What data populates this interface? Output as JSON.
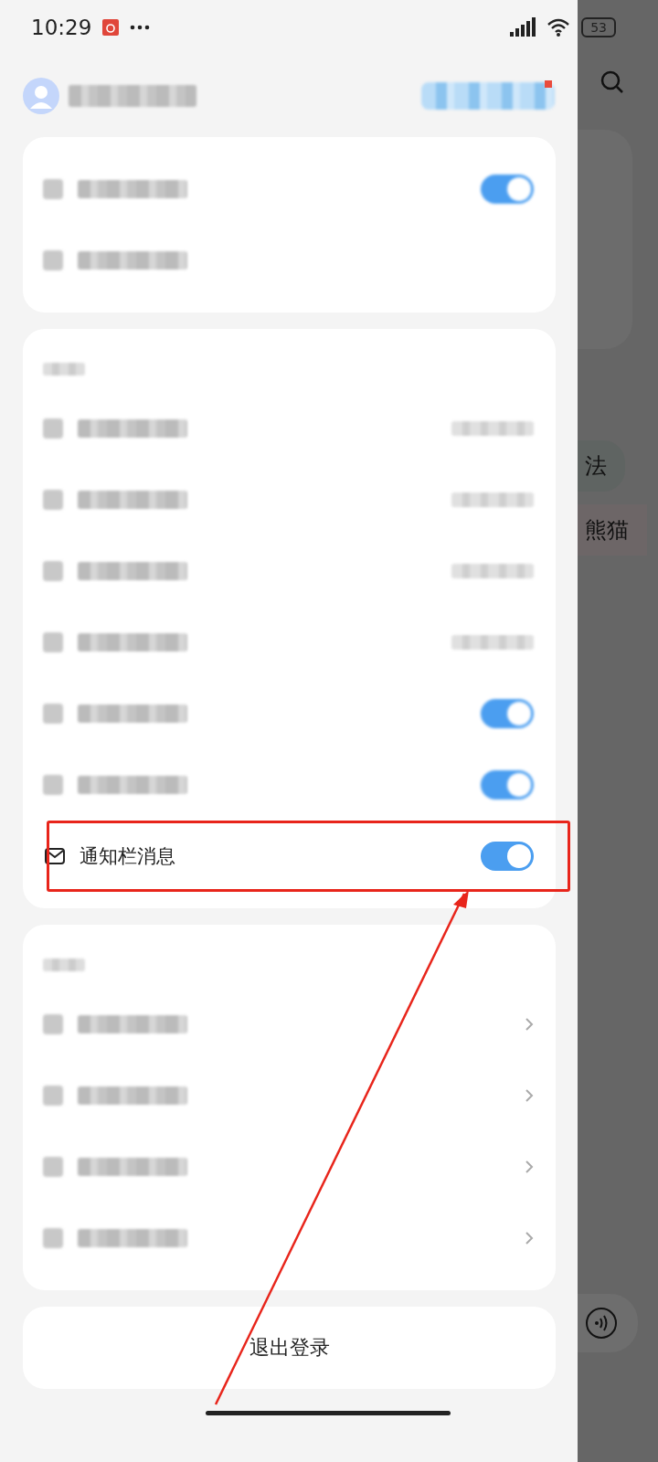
{
  "status_bar": {
    "time": "10:29",
    "battery": "53"
  },
  "account_card": {
    "rows": [
      {
        "kind": "toggle",
        "on": true
      },
      {
        "kind": "plain"
      }
    ]
  },
  "settings_card": {
    "rows": [
      {
        "kind": "value"
      },
      {
        "kind": "value"
      },
      {
        "kind": "value"
      },
      {
        "kind": "value"
      },
      {
        "kind": "toggle",
        "on": true
      },
      {
        "kind": "toggle",
        "on": true
      },
      {
        "kind": "toggle",
        "on": true,
        "label": "通知栏消息",
        "highlighted": true
      }
    ]
  },
  "other_card": {
    "rows": [
      {
        "kind": "chevron"
      },
      {
        "kind": "chevron"
      },
      {
        "kind": "chevron"
      },
      {
        "kind": "chevron"
      }
    ]
  },
  "logout_button": "退出登录",
  "background_page": {
    "texts": [
      "法",
      "熊猫"
    ]
  }
}
